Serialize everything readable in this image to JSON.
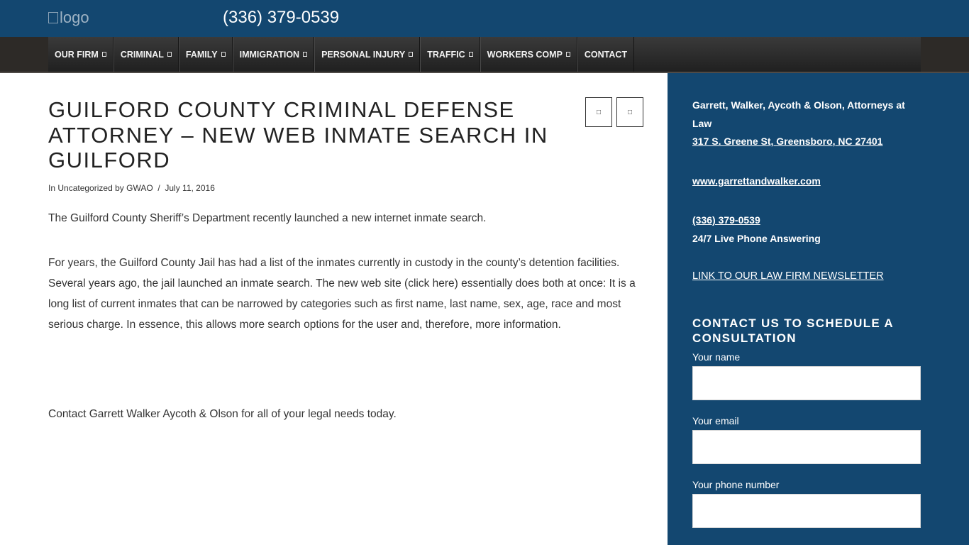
{
  "header": {
    "logo_alt": "logo",
    "phone": "(336) 379-0539"
  },
  "nav": {
    "items": [
      {
        "label": "OUR FIRM",
        "has_dropdown": true
      },
      {
        "label": "CRIMINAL",
        "has_dropdown": true
      },
      {
        "label": "FAMILY",
        "has_dropdown": true
      },
      {
        "label": "IMMIGRATION",
        "has_dropdown": true
      },
      {
        "label": "PERSONAL INJURY",
        "has_dropdown": true
      },
      {
        "label": "TRAFFIC",
        "has_dropdown": true
      },
      {
        "label": "WORKERS COMP",
        "has_dropdown": true
      },
      {
        "label": "CONTACT",
        "has_dropdown": false
      }
    ]
  },
  "post": {
    "title": "GUILFORD COUNTY CRIMINAL DEFENSE ATTORNEY – NEW WEB INMATE SEARCH IN GUILFORD",
    "meta_in": "In",
    "category": "Uncategorized",
    "meta_by": "by",
    "author": "GWAO",
    "separator": "/",
    "date": "July 11, 2016",
    "prev_icon": "arrow-left-icon",
    "next_icon": "arrow-right-icon",
    "paragraphs": [
      "The Guilford County Sheriff’s Department recently launched a new internet inmate search.",
      "For years, the Guilford County Jail has had a list of the inmates currently in custody in the county’s detention facilities. Several years ago, the jail launched an inmate search. The new web site (click here) essentially does both at once: It is a long list of current inmates that can be narrowed by categories such as first name, last name, sex, age, race and most serious charge. In essence, this allows more search options for the user and, therefore, more information.",
      "Contact Garrett Walker Aycoth & Olson for all of your legal needs today."
    ]
  },
  "sidebar": {
    "firm_name": "Garrett, Walker, Aycoth & Olson, Attorneys at Law",
    "address": "317 S. Greene St, Greensboro, NC 27401",
    "website": "www.garrettandwalker.com",
    "phone": "(336) 379-0539",
    "answering": "24/7 Live Phone Answering",
    "newsletter": "LINK TO OUR LAW FIRM NEWSLETTER",
    "form_heading": "CONTACT US TO SCHEDULE A CONSULTATION",
    "name_label": "Your name",
    "email_label": "Your email",
    "phone_label": "Your phone number"
  },
  "colors": {
    "brand_blue": "#134770",
    "nav_dark": "#2d2a27"
  }
}
